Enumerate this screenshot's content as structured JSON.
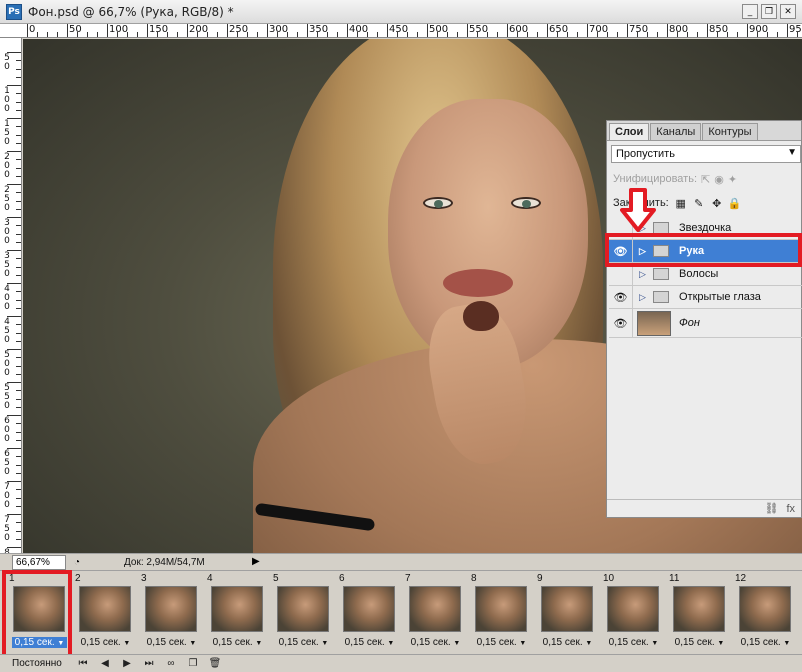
{
  "window": {
    "title": "Фон.psd @ 66,7% (Рука, RGB/8) *",
    "app_icon": "Ps",
    "minimize": "_",
    "restore": "❐",
    "close": "✕"
  },
  "ruler_top": {
    "labels": [
      "0",
      "50",
      "100",
      "150",
      "200",
      "250",
      "300",
      "350",
      "400",
      "450",
      "500",
      "550",
      "600",
      "650",
      "700",
      "750",
      "800",
      "850",
      "900",
      "950"
    ]
  },
  "ruler_left": {
    "labels": [
      "50",
      "100",
      "150",
      "200",
      "250",
      "300",
      "350",
      "400",
      "450",
      "500",
      "550",
      "600",
      "650",
      "700",
      "750",
      "800"
    ]
  },
  "layers_panel": {
    "tabs": [
      {
        "label": "Слои"
      },
      {
        "label": "Каналы"
      },
      {
        "label": "Контуры"
      }
    ],
    "blend_mode": "Пропустить",
    "unify_label": "Унифицировать:",
    "lock_label": "Закрепить:",
    "layers": [
      {
        "name": "Звездочка",
        "visible": false,
        "type": "group"
      },
      {
        "name": "Рука",
        "visible": true,
        "type": "group",
        "selected": true
      },
      {
        "name": "Волосы",
        "visible": false,
        "type": "group"
      },
      {
        "name": "Открытые глаза",
        "visible": true,
        "type": "group"
      },
      {
        "name": "Фон",
        "visible": true,
        "type": "image"
      }
    ],
    "footer_icons": [
      "link-icon",
      "fx-icon"
    ],
    "footer_fx": "fx"
  },
  "status_bar": {
    "zoom": "66,67%",
    "doc_info": "Док: 2,94M/54,7M"
  },
  "animation": {
    "frames": [
      {
        "number": "1",
        "delay": "0,15 сек.",
        "selected": true
      },
      {
        "number": "2",
        "delay": "0,15 сек."
      },
      {
        "number": "3",
        "delay": "0,15 сек."
      },
      {
        "number": "4",
        "delay": "0,15 сек."
      },
      {
        "number": "5",
        "delay": "0,15 сек."
      },
      {
        "number": "6",
        "delay": "0,15 сек."
      },
      {
        "number": "7",
        "delay": "0,15 сек."
      },
      {
        "number": "8",
        "delay": "0,15 сек."
      },
      {
        "number": "9",
        "delay": "0,15 сек."
      },
      {
        "number": "10",
        "delay": "0,15 сек."
      },
      {
        "number": "11",
        "delay": "0,15 сек."
      },
      {
        "number": "12",
        "delay": "0,15 сек."
      }
    ],
    "loop": "Постоянно"
  },
  "colors": {
    "selection": "#3f7fd4",
    "annotation_red": "#e31b23"
  }
}
